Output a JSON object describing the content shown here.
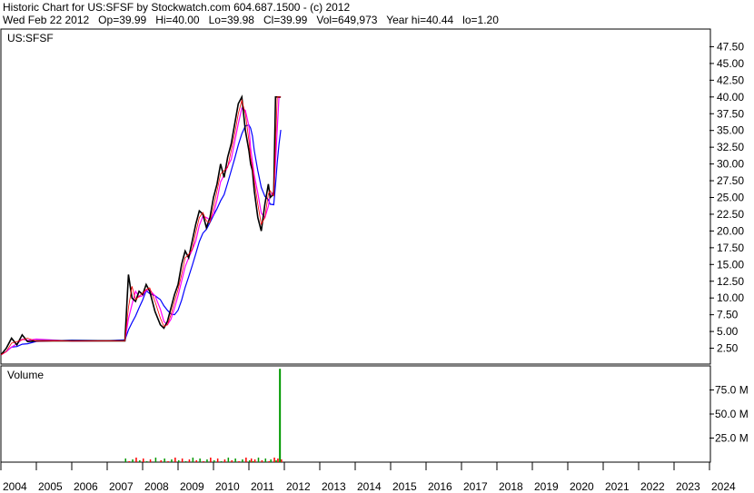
{
  "header": {
    "line1": "Historic Chart for US:SFSF by Stockwatch.com 604.687.1500 - (c) 2012",
    "line2": "Wed Feb 22 2012   Op=39.99   Hi=40.00   Lo=39.98   Cl=39.99   Vol=649,973   Year hi=40.44   lo=1.20"
  },
  "colors": {
    "price": "#000000",
    "ma_short": "#ff0000",
    "ma_mid": "#ff00ff",
    "ma_long": "#0000ff",
    "volume_up": "#009900",
    "volume_down": "#ff0000"
  },
  "chart_data": [
    {
      "type": "line",
      "title": "US:SFSF",
      "ylim": [
        0,
        50
      ],
      "yticks": [
        "47.50",
        "45.00",
        "42.50",
        "40.00",
        "37.50",
        "35.00",
        "32.50",
        "30.00",
        "27.50",
        "25.00",
        "22.50",
        "20.00",
        "17.50",
        "15.00",
        "12.50",
        "10.00",
        "7.50",
        "5.00",
        "2.50"
      ],
      "xlim": [
        2004,
        2024
      ],
      "xticks": [
        "2004",
        "2005",
        "2006",
        "2007",
        "2008",
        "2009",
        "2010",
        "2011",
        "2012",
        "2013",
        "2014",
        "2015",
        "2016",
        "2017",
        "2018",
        "2019",
        "2020",
        "2021",
        "2022",
        "2023",
        "2024"
      ],
      "grid": false,
      "series": [
        {
          "values_x": [
            2004.0,
            2004.15,
            2004.3,
            2004.45,
            2004.6,
            2004.75,
            2005.0,
            2006.0,
            2007.0,
            2007.5,
            2007.6,
            2007.7,
            2007.8,
            2007.9,
            2008.0,
            2008.1,
            2008.2,
            2008.35,
            2008.5,
            2008.6,
            2008.7,
            2008.8,
            2008.9,
            2009.0,
            2009.1,
            2009.2,
            2009.3,
            2009.4,
            2009.5,
            2009.6,
            2009.7,
            2009.8,
            2009.9,
            2010.0,
            2010.1,
            2010.2,
            2010.3,
            2010.4,
            2010.5,
            2010.6,
            2010.7,
            2010.8,
            2010.9,
            2011.0,
            2011.05,
            2011.1,
            2011.15,
            2011.25,
            2011.35,
            2011.45,
            2011.55,
            2011.6,
            2011.7,
            2011.75,
            2011.8,
            2011.85,
            2011.9
          ],
          "values_y": [
            1.5,
            2.5,
            4.0,
            3.0,
            4.5,
            3.5,
            3.6,
            3.6,
            3.6,
            3.6,
            13.5,
            10.0,
            9.5,
            11.0,
            10.5,
            12.0,
            11.0,
            8.0,
            6.0,
            5.5,
            6.5,
            8.5,
            10.5,
            12.0,
            15.0,
            17.0,
            16.0,
            18.5,
            21.0,
            23.0,
            22.5,
            20.5,
            22.0,
            25.0,
            27.0,
            30.0,
            28.0,
            31.0,
            33.0,
            36.0,
            39.0,
            40.0,
            35.0,
            32.0,
            30.0,
            29.0,
            26.0,
            22.0,
            20.0,
            24.0,
            27.0,
            25.0,
            25.5,
            40.0,
            40.0,
            39.99,
            39.99
          ]
        }
      ]
    },
    {
      "type": "bar",
      "title": "Volume",
      "yticks": [
        "75.0 M",
        "50.0 M",
        "25.0 M"
      ],
      "ylim": [
        0,
        100
      ],
      "spike": {
        "x": 2011.85,
        "value": 97
      }
    }
  ]
}
